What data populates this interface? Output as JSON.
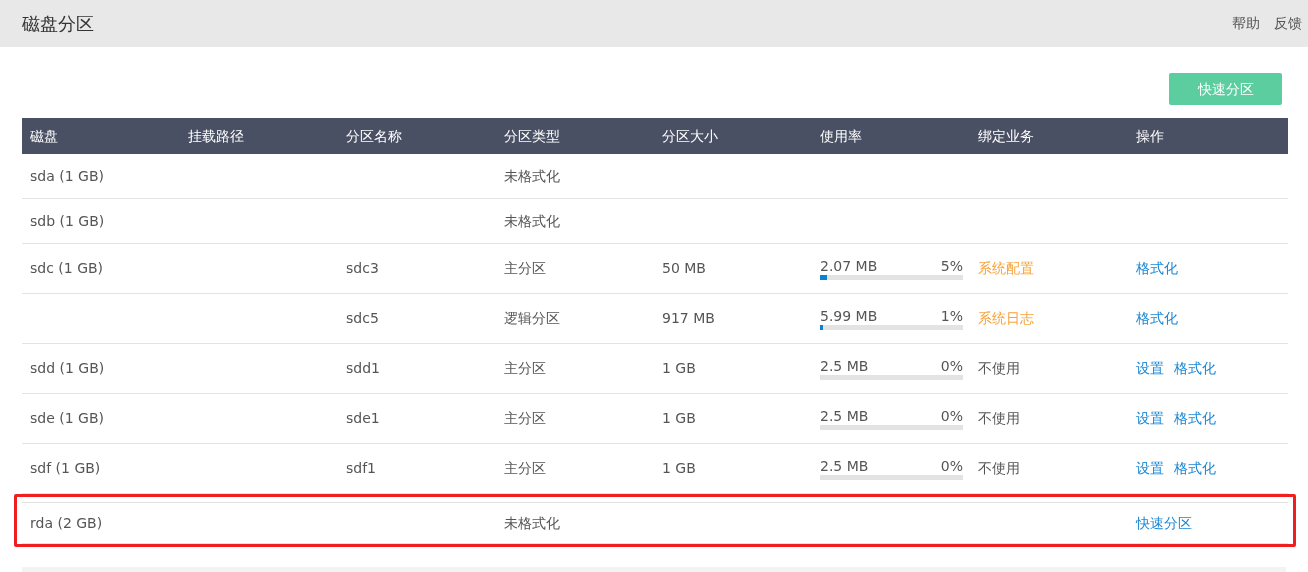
{
  "header": {
    "title": "磁盘分区",
    "links": [
      "帮助",
      "反馈"
    ]
  },
  "quick_button": "快速分区",
  "table": {
    "columns": [
      "磁盘",
      "挂载路径",
      "分区名称",
      "分区类型",
      "分区大小",
      "使用率",
      "绑定业务",
      "操作"
    ],
    "rows": [
      {
        "disk": "sda (1 GB)",
        "type": "未格式化",
        "highlighted": false
      },
      {
        "disk": "sdb (1 GB)",
        "type": "未格式化",
        "highlighted": false
      },
      {
        "disk": "sdc (1 GB)",
        "name": "sdc3",
        "type": "主分区",
        "size": "50 MB",
        "usage": {
          "used": "2.07 MB",
          "percent": "5%",
          "level": 0.05
        },
        "service": {
          "text": "系统配置",
          "color": "#f5a33b"
        },
        "actions": [
          "格式化"
        ],
        "highlighted": false
      },
      {
        "name": "sdc5",
        "type": "逻辑分区",
        "size": "917 MB",
        "usage": {
          "used": "5.99 MB",
          "percent": "1%",
          "level": 0.01
        },
        "service": {
          "text": "系统日志",
          "color": "#f5a33b"
        },
        "actions": [
          "格式化"
        ],
        "highlighted": false
      },
      {
        "disk": "sdd (1 GB)",
        "name": "sdd1",
        "type": "主分区",
        "size": "1 GB",
        "usage": {
          "used": "2.5 MB",
          "percent": "0%",
          "level": 0
        },
        "service": {
          "text": "不使用",
          "color": "#555555"
        },
        "actions": [
          "设置",
          "格式化"
        ],
        "highlighted": false
      },
      {
        "disk": "sde (1 GB)",
        "name": "sde1",
        "type": "主分区",
        "size": "1 GB",
        "usage": {
          "used": "2.5 MB",
          "percent": "0%",
          "level": 0
        },
        "service": {
          "text": "不使用",
          "color": "#555555"
        },
        "actions": [
          "设置",
          "格式化"
        ],
        "highlighted": false
      },
      {
        "disk": "sdf (1 GB)",
        "name": "sdf1",
        "type": "主分区",
        "size": "1 GB",
        "usage": {
          "used": "2.5 MB",
          "percent": "0%",
          "level": 0
        },
        "service": {
          "text": "不使用",
          "color": "#555555"
        },
        "actions": [
          "设置",
          "格式化"
        ],
        "highlighted": false
      },
      {
        "disk": "rda (2 GB)",
        "type": "未格式化",
        "actions": [
          "快速分区"
        ],
        "highlighted": true
      }
    ]
  }
}
